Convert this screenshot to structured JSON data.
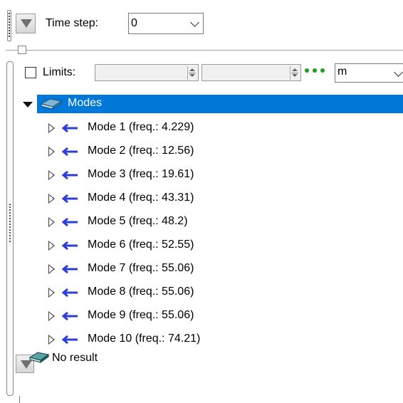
{
  "toolbar": {
    "time_step_label": "Time step:",
    "time_step_value": "0"
  },
  "limits": {
    "checkbox_label": "Limits:",
    "min_value": "",
    "max_value": "",
    "unit_value": "m"
  },
  "tree": {
    "root_label": "Modes",
    "modes": [
      {
        "label": "Mode 1 (freq.: 4.229)"
      },
      {
        "label": "Mode 2 (freq.: 12.56)"
      },
      {
        "label": "Mode 3 (freq.: 19.61)"
      },
      {
        "label": "Mode 4 (freq.: 43.31)"
      },
      {
        "label": "Mode 5 (freq.: 48.2)"
      },
      {
        "label": "Mode 6 (freq.: 52.55)"
      },
      {
        "label": "Mode 7 (freq.: 55.06)"
      },
      {
        "label": "Mode 8 (freq.: 55.06)"
      },
      {
        "label": "Mode 9 (freq.: 55.06)"
      },
      {
        "label": "Mode 10 (freq.: 74.21)"
      }
    ],
    "no_result_label": "No result"
  },
  "colors": {
    "selection": "#0078d7",
    "mode_arrow": "#2b3fd6",
    "ellipsis_dots": "#1aa11a"
  },
  "icons": {
    "root": "book-icon",
    "mode": "arrow-left-icon",
    "no_result": "book-icon",
    "ellipsis": "ellipsis-icon"
  }
}
